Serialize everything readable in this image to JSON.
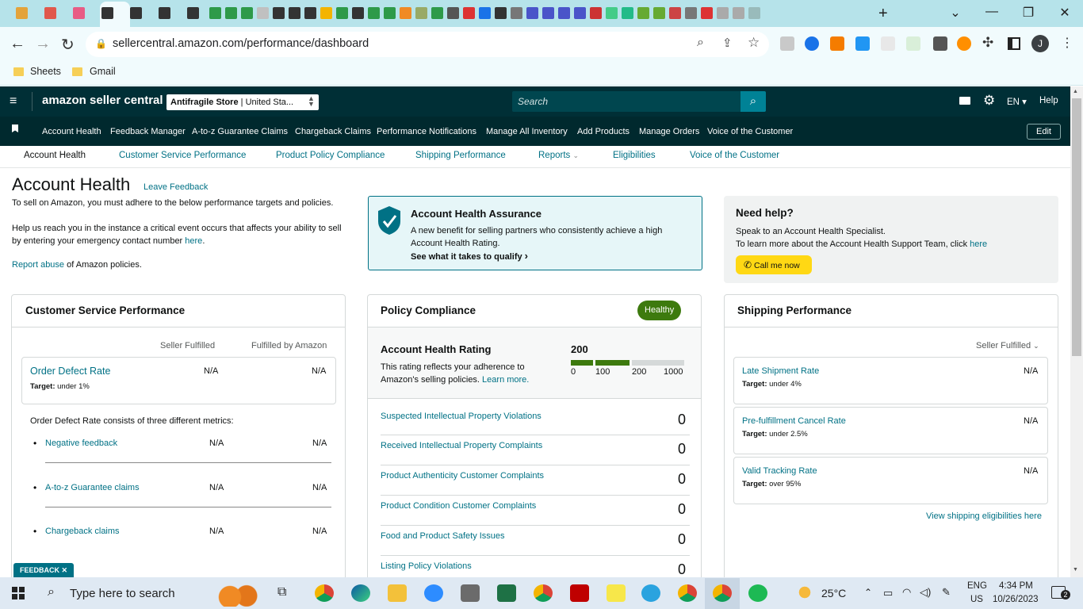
{
  "browser": {
    "url": "sellercentral.amazon.com/performance/dashboard",
    "bookmarks": [
      "Sheets",
      "Gmail"
    ],
    "profile_initial": "J",
    "new_tab_symbol": "+"
  },
  "header": {
    "logo": "amazon seller central",
    "store_name": "Antifragile Store",
    "store_region": "United Sta...",
    "search_placeholder": "Search",
    "language": "EN",
    "help": "Help"
  },
  "navbar": {
    "items": [
      "Account Health",
      "Feedback Manager",
      "A-to-z Guarantee Claims",
      "Chargeback Claims",
      "Performance Notifications",
      "Manage All Inventory",
      "Add Products",
      "Manage Orders",
      "Voice of the Customer"
    ],
    "edit": "Edit"
  },
  "subnav": {
    "items": [
      "Account Health",
      "Customer Service Performance",
      "Product Policy Compliance",
      "Shipping Performance",
      "Reports",
      "Eligibilities",
      "Voice of the Customer"
    ]
  },
  "page": {
    "title": "Account Health",
    "leave_feedback": "Leave Feedback",
    "intro1": "To sell on Amazon, you must adhere to the below performance targets and policies.",
    "intro2a": "Help us reach you in the instance a critical event occurs that affects your ability to sell by entering your emergency contact number ",
    "intro2_link": "here",
    "intro2b": ".",
    "report_abuse": "Report abuse",
    "report_abuse_rest": " of Amazon policies."
  },
  "assurance": {
    "title": "Account Health Assurance",
    "text": "A new benefit for selling partners who consistently achieve a high Account Health Rating.",
    "link": "See what it takes to qualify"
  },
  "help_box": {
    "title": "Need help?",
    "line1": "Speak to an Account Health Specialist.",
    "line2": "To learn more about the Account Health Support Team, click ",
    "line2_link": "here",
    "button": "Call me now"
  },
  "customer_service": {
    "title": "Customer Service Performance",
    "col1": "Seller Fulfilled",
    "col2": "Fulfilled by Amazon",
    "odr_label": "Order Defect Rate",
    "odr_target_label": "Target:",
    "odr_target": " under 1%",
    "odr_v1": "N/A",
    "odr_v2": "N/A",
    "consists": "Order Defect Rate consists of three different metrics:",
    "metrics": [
      {
        "label": "Negative feedback",
        "v1": "N/A",
        "v2": "N/A"
      },
      {
        "label": "A-to-z Guarantee claims",
        "v1": "N/A",
        "v2": "N/A"
      },
      {
        "label": "Chargeback claims",
        "v1": "N/A",
        "v2": "N/A"
      }
    ]
  },
  "policy": {
    "title": "Policy Compliance",
    "badge": "Healthy",
    "rating_title": "Account Health Rating",
    "rating_value": "200",
    "rating_text": "This rating reflects your adherence to Amazon's selling policies. ",
    "learn_more": "Learn more.",
    "scale": [
      "0",
      "100",
      "200",
      "1000"
    ],
    "rows": [
      {
        "label": "Suspected Intellectual Property Violations",
        "value": "0"
      },
      {
        "label": "Received Intellectual Property Complaints",
        "value": "0"
      },
      {
        "label": "Product Authenticity Customer Complaints",
        "value": "0"
      },
      {
        "label": "Product Condition Customer Complaints",
        "value": "0"
      },
      {
        "label": "Food and Product Safety Issues",
        "value": "0"
      },
      {
        "label": "Listing Policy Violations",
        "value": "0"
      }
    ]
  },
  "shipping": {
    "title": "Shipping Performance",
    "filter": "Seller Fulfilled",
    "metrics": [
      {
        "label": "Late Shipment Rate",
        "target_label": "Target:",
        "target": " under 4%",
        "value": "N/A"
      },
      {
        "label": "Pre-fulfillment Cancel Rate",
        "target_label": "Target:",
        "target": " under 2.5%",
        "value": "N/A"
      },
      {
        "label": "Valid Tracking Rate",
        "target_label": "Target:",
        "target": " over 95%",
        "value": "N/A"
      }
    ],
    "view_link": "View shipping eligibilities here"
  },
  "feedback_tab": "FEEDBACK ✕",
  "taskbar": {
    "search": "Type here to search",
    "weather": "25°C",
    "lang1": "ENG",
    "lang2": "US",
    "time": "4:34 PM",
    "date": "10/26/2023",
    "notif_count": "2"
  },
  "colors": {
    "brand_dark": "#002f36",
    "link": "#007185",
    "healthy": "#3d7a0e",
    "call_button": "#ffd814"
  }
}
